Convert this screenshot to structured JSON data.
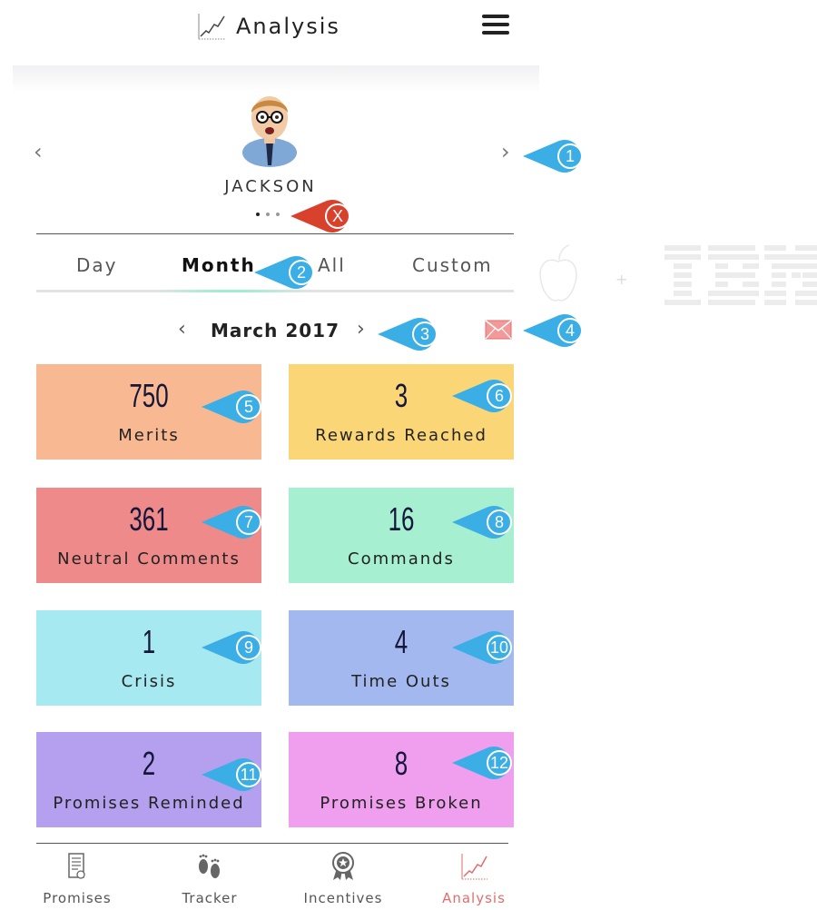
{
  "header": {
    "title": "Analysis",
    "title_icon": "line-chart-icon",
    "menu_icon": "hamburger-menu-icon"
  },
  "profile": {
    "name": "JACKSON",
    "avatar": "child-avatar",
    "prev_icon": "chevron-left-icon",
    "next_icon": "chevron-right-icon",
    "page_count": 3,
    "active_page": 1
  },
  "tabs": [
    {
      "label": "Day",
      "active": false
    },
    {
      "label": "Month",
      "active": true
    },
    {
      "label": "All",
      "active": false
    },
    {
      "label": "Custom",
      "active": false
    }
  ],
  "period": {
    "label": "March 2017",
    "prev_icon": "chevron-left-icon",
    "next_icon": "chevron-right-icon",
    "action_icon": "mail-icon"
  },
  "stats": [
    {
      "value": "750",
      "label": "Merits",
      "color": "#f8b891"
    },
    {
      "value": "3",
      "label": "Rewards Reached",
      "color": "#fad677"
    },
    {
      "value": "361",
      "label": "Neutral Comments",
      "color": "#ee8a89"
    },
    {
      "value": "16",
      "label": "Commands",
      "color": "#a6efd1"
    },
    {
      "value": "1",
      "label": "Crisis",
      "color": "#a6e9f0"
    },
    {
      "value": "4",
      "label": "Time Outs",
      "color": "#a3b8ef"
    },
    {
      "value": "2",
      "label": "Promises Reminded",
      "color": "#b4a0ee"
    },
    {
      "value": "8",
      "label": "Promises Broken",
      "color": "#ef9fee"
    }
  ],
  "nav": [
    {
      "label": "Promises",
      "icon": "certificate-icon",
      "active": false
    },
    {
      "label": "Tracker",
      "icon": "footprints-icon",
      "active": false
    },
    {
      "label": "Incentives",
      "icon": "award-icon",
      "active": false
    },
    {
      "label": "Analysis",
      "icon": "line-chart-icon",
      "active": true
    }
  ],
  "callouts": [
    "1",
    "X",
    "2",
    "3",
    "4",
    "5",
    "6",
    "7",
    "8",
    "9",
    "10",
    "11",
    "12"
  ],
  "colors": {
    "callout_blue": "#3aaee5",
    "callout_red": "#d8412c",
    "accent": "#e26d6d",
    "tab_indicator": "#a2ecd6"
  },
  "brands": {
    "apple_logo": "apple-logo",
    "separator": "+",
    "ibm_logo": "IBM"
  }
}
